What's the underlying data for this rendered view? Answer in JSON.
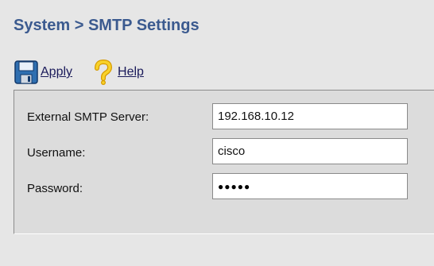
{
  "header": {
    "title": "System > SMTP Settings"
  },
  "toolbar": {
    "apply_label": "Apply",
    "help_label": "Help",
    "apply_icon": "floppy-disk-icon",
    "help_icon": "question-mark-icon"
  },
  "form": {
    "smtp_server": {
      "label": "External SMTP Server:",
      "value": "192.168.10.12"
    },
    "username": {
      "label": "Username:",
      "value": "cisco"
    },
    "password": {
      "label": "Password:",
      "masked": "●●●●●"
    }
  },
  "colors": {
    "background": "#e6e6e6",
    "panel": "#dcdcdc",
    "title": "#3b5a8f",
    "link": "#1a1a5a"
  }
}
